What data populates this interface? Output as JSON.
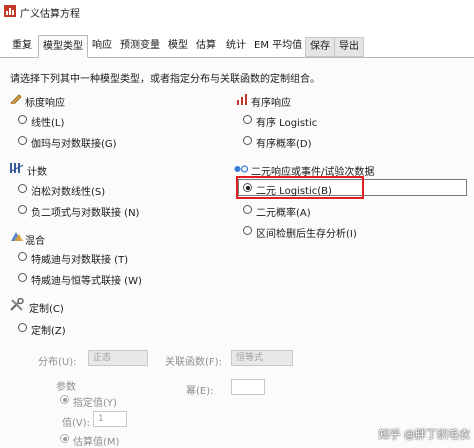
{
  "window": {
    "title": "广义估算方程"
  },
  "tabs": [
    "重复",
    "模型类型",
    "响应",
    "预测变量",
    "模型",
    "估算",
    "统计",
    "EM 平均值",
    "保存",
    "导出"
  ],
  "instruction": "请选择下列其中一种模型类型，或者指定分布与关联函数的定制组合。",
  "scale_response": {
    "heading": "标度响应",
    "opt1": "线性(L)",
    "opt2": "伽玛与对数联接(G)"
  },
  "ordinal_response": {
    "heading": "有序响应",
    "opt1": "有序 Logistic",
    "opt2": "有序概率(D)"
  },
  "counts": {
    "heading": "计数",
    "opt1": "泊松对数线性(S)",
    "opt2": "负二项式与对数联接 (N)"
  },
  "binary_response": {
    "heading": "二元响应或事件/试验次数据",
    "opt1": "二元 Logistic(B)",
    "opt2": "二元概率(A)",
    "opt3": "区间检删后生存分析(I)"
  },
  "mixture": {
    "heading": "混合",
    "opt1": "特威迪与对数联接 (T)",
    "opt2": "特威迪与恒等式联接 (W)"
  },
  "custom": {
    "heading": "定制(C)",
    "opt": "定制(Z)",
    "distribution_label": "分布(U):",
    "distribution_value": "正态",
    "link_label": "关联函数(F):",
    "link_value": "恒等式",
    "power_label": "幂(E):",
    "power_value": "",
    "params_label": "参数",
    "specify_label": "指定值(Y)",
    "value_label": "值(V):",
    "value_value": "1",
    "estimate_label": "估算值(M)"
  },
  "watermark": "知乎 @胖丁织毛衣"
}
